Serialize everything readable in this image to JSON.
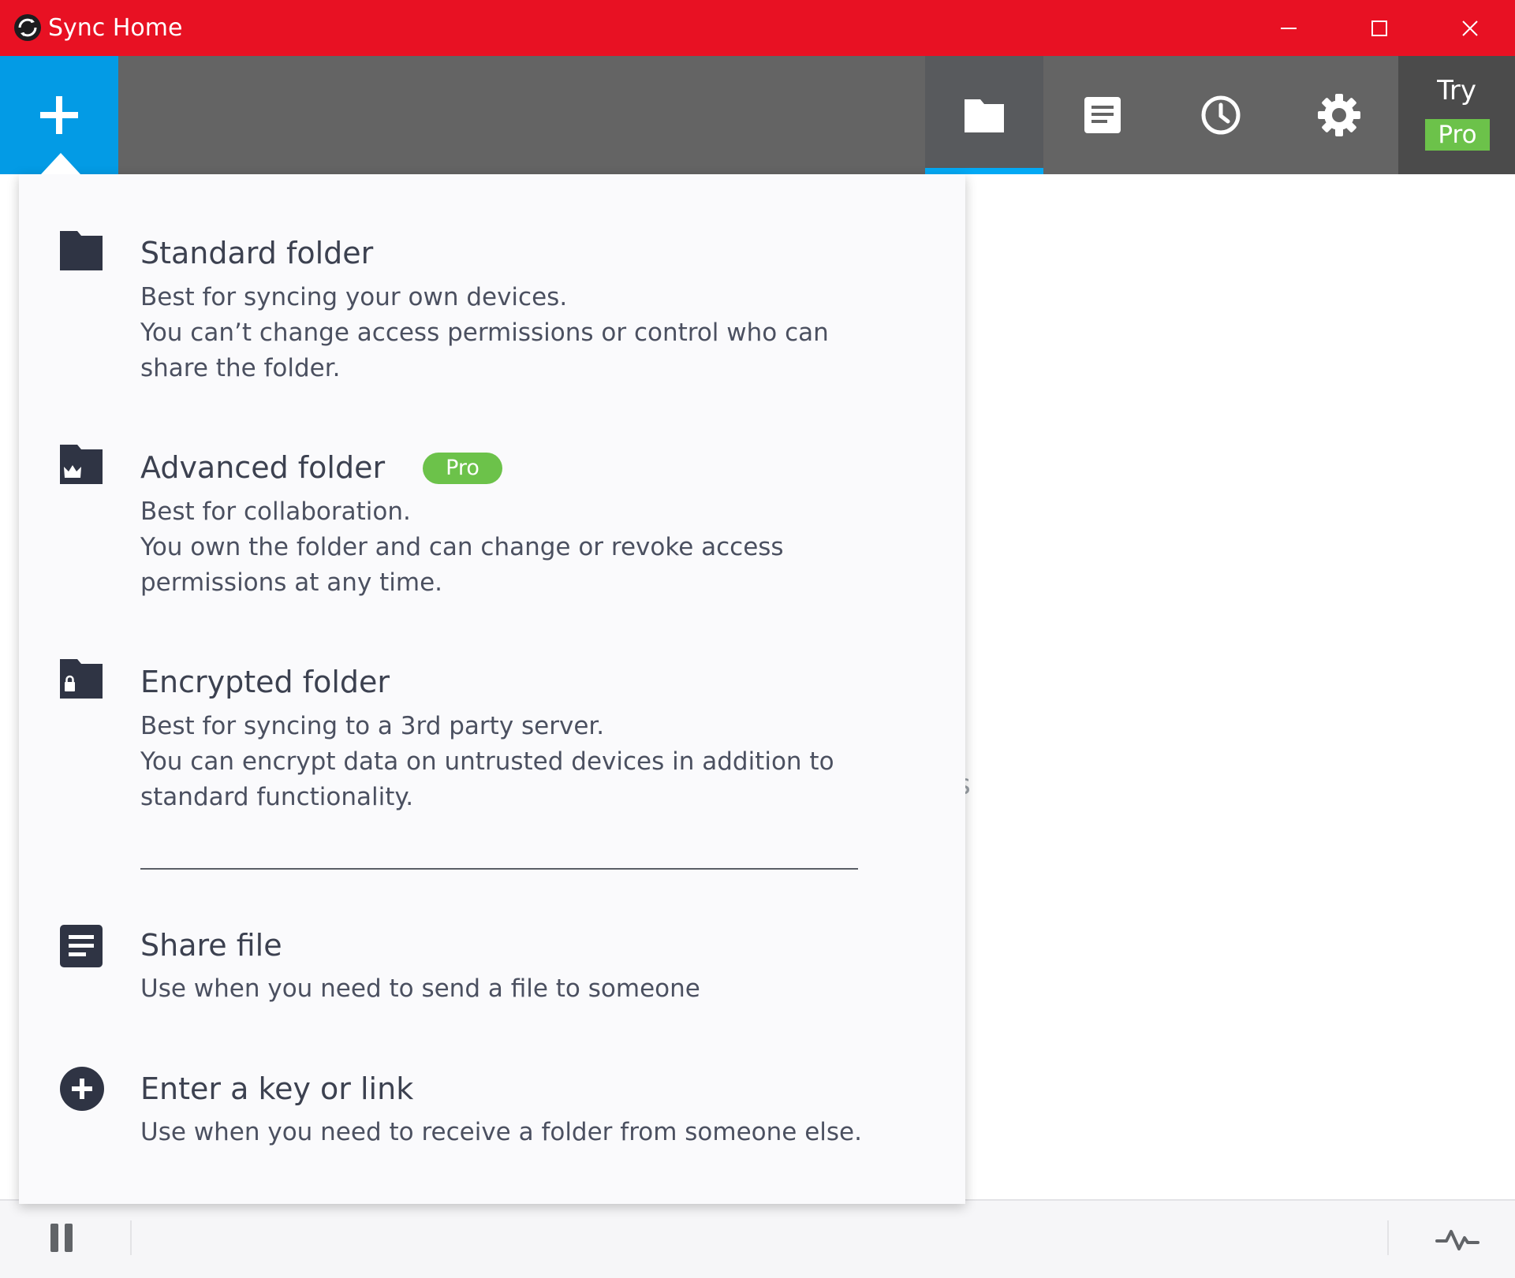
{
  "window": {
    "title": "Sync Home",
    "accent_color": "#e81123",
    "minimize_icon": "minimize-icon",
    "maximize_icon": "maximize-icon",
    "close_icon": "close-icon"
  },
  "toolbar": {
    "add_icon": "plus-icon",
    "add_color": "#039be5",
    "tabs": [
      {
        "icon": "folder-icon",
        "active": true
      },
      {
        "icon": "document-icon",
        "active": false
      },
      {
        "icon": "clock-icon",
        "active": false
      },
      {
        "icon": "gear-icon",
        "active": false
      }
    ],
    "try_label": "Try",
    "pro_label": "Pro",
    "pro_color": "#6cc24a"
  },
  "menu": {
    "items": [
      {
        "icon": "folder-icon",
        "title": "Standard folder",
        "desc": "Best for syncing your own devices.\nYou can’t change access permissions or control who can share the folder."
      },
      {
        "icon": "folder-crown-icon",
        "title": "Advanced folder",
        "badge": "Pro",
        "desc": "Best for collaboration.\nYou own the folder and can change or revoke access permissions at any time."
      },
      {
        "icon": "folder-lock-icon",
        "title": "Encrypted folder",
        "desc": "Best for syncing to a 3rd party server.\nYou can encrypt data on untrusted devices in addition to standard functionality."
      },
      {
        "icon": "document-icon",
        "title": "Share file",
        "desc": "Use when you need to send a file to someone"
      },
      {
        "icon": "plus-circle-icon",
        "title": "Enter a key or link",
        "desc": "Use when you need to receive a folder from someone else."
      }
    ]
  },
  "background": {
    "partial_text": "s"
  },
  "statusbar": {
    "pause_icon": "pause-icon",
    "activity_icon": "activity-icon"
  }
}
